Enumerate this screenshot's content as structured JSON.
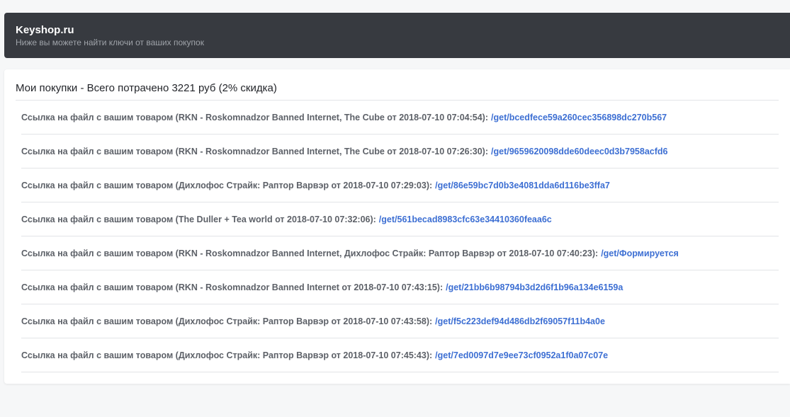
{
  "header": {
    "title": "Keyshop.ru",
    "subtitle": "Ниже вы можете найти ключи от ваших покупок"
  },
  "purchases": {
    "title": "Мои покупки - Всего потрачено 3221 руб (2% скидка)",
    "items": [
      {
        "text": "Ссылка на файл с вашим товаром (RKN - Roskomnadzor Banned Internet, The Cube от 2018-07-10 07:04:54):",
        "link": "/get/bcedfece59a260cec356898dc270b567"
      },
      {
        "text": "Ссылка на файл с вашим товаром (RKN - Roskomnadzor Banned Internet, The Cube от 2018-07-10 07:26:30):",
        "link": "/get/9659620098dde60deec0d3b7958acfd6"
      },
      {
        "text": "Ссылка на файл с вашим товаром (Дихлофос Страйк: Раптор Варвэр от 2018-07-10 07:29:03):",
        "link": "/get/86e59bc7d0b3e4081dda6d116be3ffa7"
      },
      {
        "text": "Ссылка на файл с вашим товаром (The Duller + Tea world от 2018-07-10 07:32:06):",
        "link": "/get/561becad8983cfc63e34410360feaa6c"
      },
      {
        "text": "Ссылка на файл с вашим товаром (RKN - Roskomnadzor Banned Internet, Дихлофос Страйк: Раптор Варвэр от 2018-07-10 07:40:23):",
        "link": "/get/Формируется"
      },
      {
        "text": "Ссылка на файл с вашим товаром (RKN - Roskomnadzor Banned Internet от 2018-07-10 07:43:15):",
        "link": "/get/21bb6b98794b3d2d6f1b96a134e6159a"
      },
      {
        "text": "Ссылка на файл с вашим товаром (Дихлофос Страйк: Раптор Варвэр от 2018-07-10 07:43:58):",
        "link": "/get/f5c223def94d486db2f69057f11b4a0e"
      },
      {
        "text": "Ссылка на файл с вашим товаром (Дихлофос Страйк: Раптор Варвэр от 2018-07-10 07:45:43):",
        "link": "/get/7ed0097d7e9ee73cf0952a1f0a07c07e"
      }
    ]
  },
  "colors": {
    "header_bg": "#373a40",
    "link": "#3d6fd3",
    "item_text": "#5d6168",
    "page_bg": "#f6f7f8"
  }
}
